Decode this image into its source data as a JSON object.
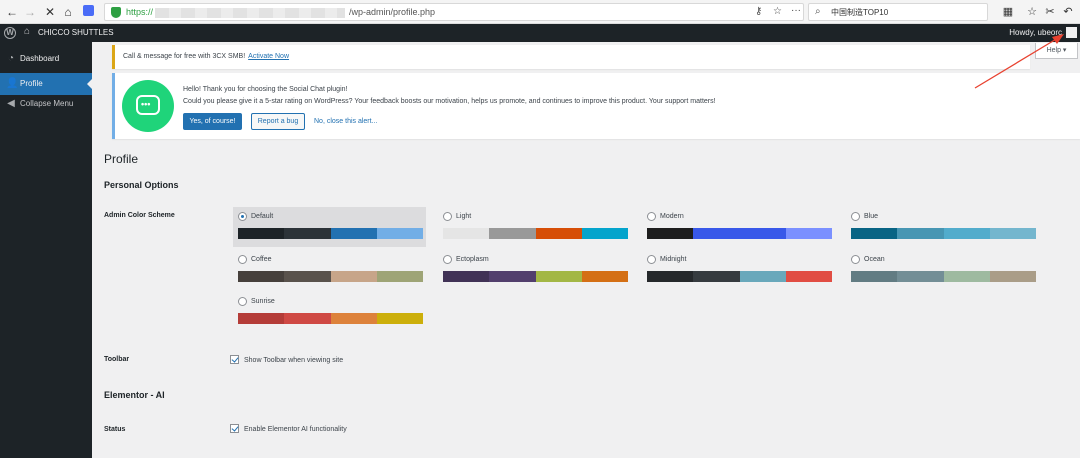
{
  "browser": {
    "url_scheme": "https://",
    "url_path": "/wp-admin/profile.php",
    "search_text": "中国制造TOP10"
  },
  "adminbar": {
    "site_name": "CHICCO SHUTTLES",
    "howdy": "Howdy, ubeorc"
  },
  "sidebar": {
    "items": [
      {
        "label": "Dashboard"
      },
      {
        "label": "Profile"
      },
      {
        "label": "Collapse Menu"
      }
    ]
  },
  "notice_3cx": {
    "text": "Call & message for free with 3CX SMB!",
    "link": "Activate Now"
  },
  "help_button": "Help ▾",
  "chat_notice": {
    "line1": "Hello! Thank you for choosing the Social Chat plugin!",
    "line2": "Could you please give it a 5-star rating on WordPress? Your feedback boosts our motivation, helps us promote, and continues to improve this product. Your support matters!",
    "btn_yes": "Yes, of course!",
    "btn_bug": "Report a bug",
    "link_close": "No, close this alert..."
  },
  "page": {
    "title": "Profile",
    "personal_options": "Personal Options",
    "admin_color_scheme": "Admin Color Scheme",
    "toolbar_label": "Toolbar",
    "toolbar_check": "Show Toolbar when viewing site",
    "elementor_heading": "Elementor - AI",
    "status_label": "Status",
    "status_check": "Enable Elementor AI functionality"
  },
  "color_schemes": [
    {
      "name": "Default",
      "selected": true,
      "colors": [
        "#1d2327",
        "#2c3338",
        "#2271b1",
        "#72aee6"
      ]
    },
    {
      "name": "Light",
      "selected": false,
      "colors": [
        "#e5e5e5",
        "#999999",
        "#d64e07",
        "#04a4cc"
      ]
    },
    {
      "name": "Modern",
      "selected": false,
      "colors": [
        "#1e1e1e",
        "#3858e9",
        "#3858e9",
        "#7b90ff"
      ]
    },
    {
      "name": "Blue",
      "selected": false,
      "colors": [
        "#096484",
        "#4796b3",
        "#52accc",
        "#74b6ce"
      ]
    },
    {
      "name": "Coffee",
      "selected": false,
      "colors": [
        "#46403c",
        "#59524c",
        "#c7a589",
        "#9ea476"
      ]
    },
    {
      "name": "Ectoplasm",
      "selected": false,
      "colors": [
        "#413256",
        "#523f6d",
        "#a3b745",
        "#d46f15"
      ]
    },
    {
      "name": "Midnight",
      "selected": false,
      "colors": [
        "#25282b",
        "#363b3f",
        "#69a8bb",
        "#e14d43"
      ]
    },
    {
      "name": "Ocean",
      "selected": false,
      "colors": [
        "#627c83",
        "#738e96",
        "#9ebaa0",
        "#aa9d88"
      ]
    },
    {
      "name": "Sunrise",
      "selected": false,
      "colors": [
        "#b43c38",
        "#cf4944",
        "#dd823b",
        "#ccaf0b"
      ]
    }
  ]
}
